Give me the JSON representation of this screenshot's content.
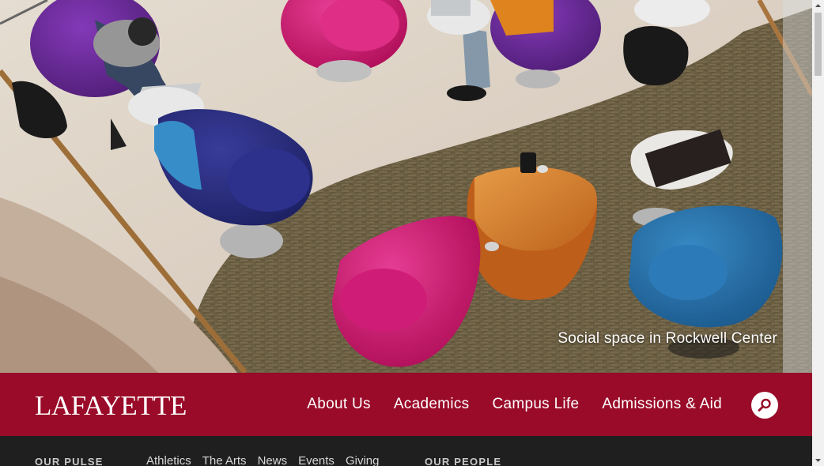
{
  "hero": {
    "caption": "Social space in Rockwell Center"
  },
  "header": {
    "logo_text": "LAFAYETTE",
    "nav": [
      {
        "label": "About Us"
      },
      {
        "label": "Academics"
      },
      {
        "label": "Campus Life"
      },
      {
        "label": "Admissions & Aid"
      }
    ],
    "search_icon": "search-icon"
  },
  "utility_bar": {
    "pulse_heading": "OUR PULSE",
    "links": [
      {
        "label": "Athletics"
      },
      {
        "label": "The Arts"
      },
      {
        "label": "News"
      },
      {
        "label": "Events"
      },
      {
        "label": "Giving"
      }
    ],
    "people_heading": "OUR PEOPLE"
  },
  "colors": {
    "brand": "#9a0b29",
    "utility_bg": "#1f1f1f"
  }
}
